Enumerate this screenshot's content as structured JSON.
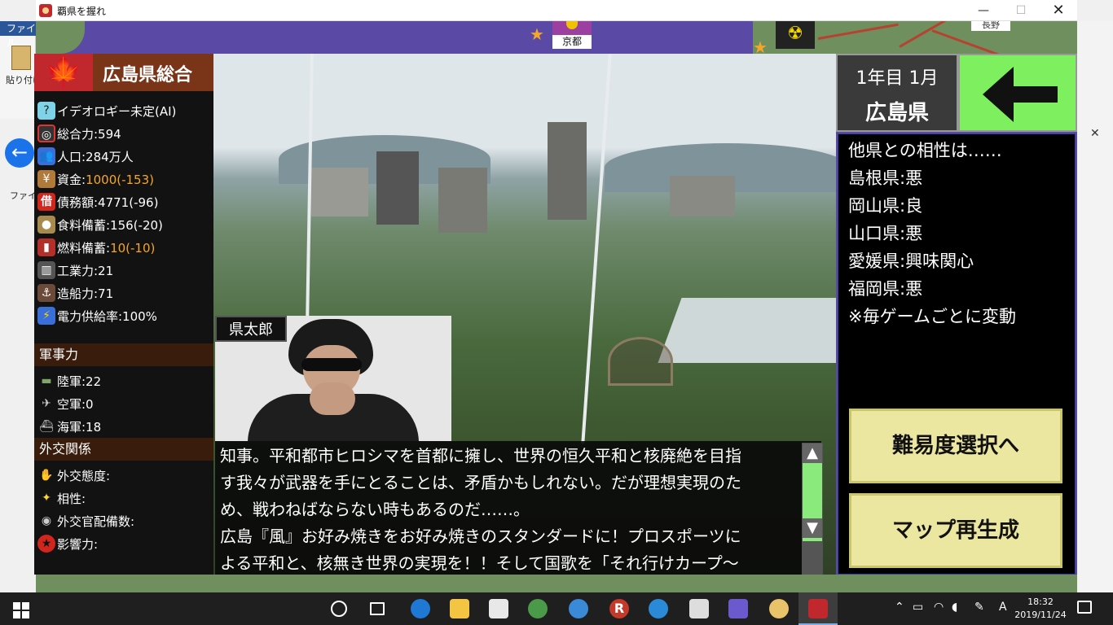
{
  "window": {
    "title": "覇県を握れ"
  },
  "background_app": {
    "file_tab": "ファイル",
    "paste_label": "貼り付け",
    "file_tab2": "ファイル"
  },
  "map": {
    "kyoto_label": "京都",
    "nagano_label": "長野"
  },
  "left_panel": {
    "prefecture_title": "広島県総合",
    "stats": [
      {
        "icon": "question-icon",
        "text": "イデオロギー未定(AI)",
        "highlight": ""
      },
      {
        "icon": "rings-icon",
        "text": "総合力:594",
        "highlight": ""
      },
      {
        "icon": "people-icon",
        "text": "人口:284万人",
        "highlight": ""
      },
      {
        "icon": "money-bag-icon",
        "text": "資金:",
        "highlight": "1000(-153)"
      },
      {
        "icon": "debt-icon",
        "text": "債務額:4771(-96)",
        "highlight": ""
      },
      {
        "icon": "food-sacks-icon",
        "text": "食料備蓄:156(-20)",
        "highlight": ""
      },
      {
        "icon": "fuel-barrel-icon",
        "text": "燃料備蓄:",
        "highlight": "10(-10)"
      },
      {
        "icon": "factory-icon",
        "text": "工業力:21",
        "highlight": ""
      },
      {
        "icon": "shipyard-icon",
        "text": "造船力:71",
        "highlight": ""
      },
      {
        "icon": "lightning-icon",
        "text": "電力供給率:100%",
        "highlight": ""
      }
    ],
    "military_header": "軍事力",
    "military": [
      {
        "icon": "tank-icon",
        "text": "陸軍:22"
      },
      {
        "icon": "jet-icon",
        "text": "空軍:0"
      },
      {
        "icon": "battleship-icon",
        "text": "海軍:18"
      }
    ],
    "diplomacy_header": "外交関係",
    "diplomacy": [
      {
        "icon": "handshake-icon",
        "text": "外交態度:"
      },
      {
        "icon": "sparkle-icon",
        "text": "相性:"
      },
      {
        "icon": "diplomat-icon",
        "text": "外交官配備数:"
      },
      {
        "icon": "red-star-icon",
        "text": "影響力:"
      }
    ]
  },
  "portrait": {
    "name": "県太郎"
  },
  "dialog": {
    "lines": [
      "知事。平和都市ヒロシマを首都に擁し、世界の恒久平和と核廃絶を目指",
      "す我々が武器を手にとることは、矛盾かもしれない。だが理想実現のた",
      "め、戦わねばならない時もあるのだ……。",
      "広島『風』お好み焼きをお好み焼きのスタンダードに！プロスポーツに",
      "よる平和と、核無き世界の実現を！！そして国歌を「それ行けカープ～"
    ],
    "scroll_up": "▲",
    "scroll_down": "▼"
  },
  "date_box": {
    "date": "1年目 1月",
    "prefecture": "広島県"
  },
  "compat_panel": {
    "lines": [
      "他県との相性は……",
      "島根県:悪",
      "岡山県:良",
      "山口県:悪",
      "愛媛県:興味関心",
      "福岡県:悪",
      "※毎ゲームごとに変動"
    ]
  },
  "buttons": {
    "difficulty": "難易度選択へ",
    "regenerate_map": "マップ再生成"
  },
  "taskbar": {
    "time": "18:32",
    "date": "2019/11/24",
    "ime": "A"
  },
  "colors": {
    "accent_green": "#7ef05f",
    "button_yellow": "#ece7a0",
    "highlight_orange": "#f5a623",
    "header_brown": "#7a3518"
  }
}
